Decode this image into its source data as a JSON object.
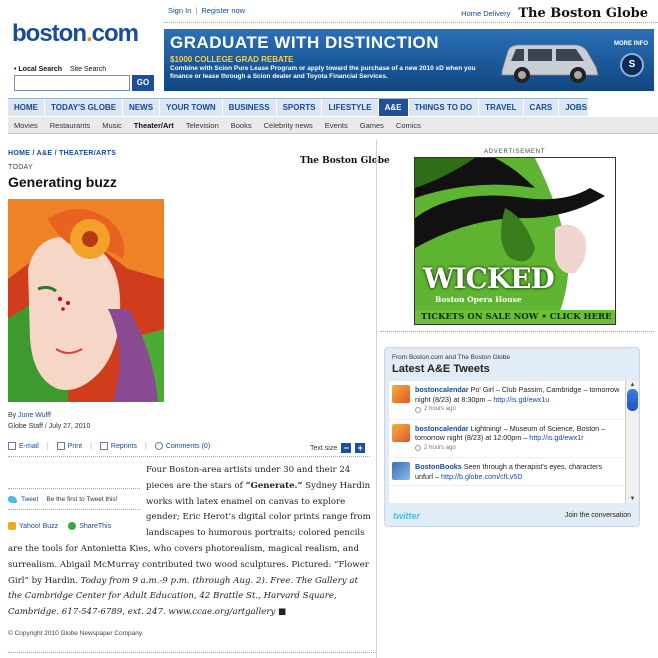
{
  "header": {
    "logo_main": "boston",
    "logo_dot": ".",
    "logo_tld": "com",
    "search_local": "Local Search",
    "search_site": "Site Search",
    "go": "GO",
    "sign_in": "Sign In",
    "register": "Register now",
    "home_delivery": "Home Delivery",
    "masthead": "The Boston Globe"
  },
  "banner": {
    "headline": "GRADUATE WITH DISTINCTION",
    "sub": "$1000 COLLEGE GRAD REBATE",
    "sub2": "Combine with Scion Pure Lease Program or apply toward the purchase of a new 2010 xD when you finance or lease through a Scion dealer and Toyota Financial Services.",
    "more_info": "MORE INFO"
  },
  "nav": {
    "tabs": [
      "HOME",
      "TODAY'S GLOBE",
      "NEWS",
      "YOUR TOWN",
      "BUSINESS",
      "SPORTS",
      "LIFESTYLE",
      "A&E",
      "THINGS TO DO",
      "TRAVEL",
      "CARS",
      "JOBS"
    ],
    "active": "A&E",
    "sub": [
      "Movies",
      "Restaurants",
      "Music",
      "Theater/Art",
      "Television",
      "Books",
      "Celebrity news",
      "Events",
      "Games",
      "Comics"
    ],
    "sub_active": "Theater/Art"
  },
  "article": {
    "breadcrumb": "HOME / A&E / THEATER/ARTS",
    "kicker": "TODAY",
    "source": "The Boston Globe",
    "title": "Generating buzz",
    "by": "By",
    "author": "June Wulff",
    "staff": "Globe Staff",
    "date": "July 27, 2010",
    "tools": [
      "E-mail",
      "Print",
      "Reprints",
      "Comments (0)"
    ],
    "text_size": "Text size",
    "tweet": "Tweet",
    "tweet_first": "Be the first to Tweet this!",
    "yahoo": "Yahoo! Buzz",
    "sharethis": "ShareThis",
    "p1": "Four Boston-area artists under 30 and their 24 pieces are the stars of ",
    "p1_bold": "“Generate.”",
    "p2": " Sydney Hardin works with latex enamel on canvas to explore gender; Eric Herot’s digital color prints range from landscapes to humorous portraits; colored pencils are the tools for Antonietta Kies, who covers photorealism, magical realism, and surrealism. Abigail McMurray contributed two wood sculptures. Pictured: “Flower Girl” by Hardin. ",
    "p3_italic": "Today from 9 a.m.-9 p.m. (through Aug. 2). Free. The Gallery at the Cambridge Center for Adult Education, 42 Brattle St., Harvard Square, Cambridge. 617-547-6789, ext. 247. www.ccae.org/artgallery",
    "end_mark": " ■",
    "copyright": "© Copyright 2010 Globe Newspaper Company."
  },
  "ad": {
    "label": "ADVERTISEMENT",
    "name": "WICKED",
    "venue": "Boston Opera House",
    "cta": "TICKETS ON SALE NOW • CLICK HERE"
  },
  "tweets": {
    "from": "From Boston.com and The Boston Globe",
    "heading": "Latest A&E Tweets",
    "items": [
      {
        "user": "bostoncalendar",
        "text": " Po' Girl – Club Passim, Cambridge – tomorrow night (8/23) at 8:30pm – ",
        "link": "http://is.gd/ewx1u",
        "ago": "2 hours ago"
      },
      {
        "user": "bostoncalendar",
        "text": " Lightning! – Museum of Science, Boston – tomorrow night (8/23) at 12:00pm – ",
        "link": "http://is.gd/ewx1r",
        "ago": "2 hours ago"
      },
      {
        "user": "BostonBooks",
        "text": " Seen through a therapist's eyes, characters unfurl – ",
        "link": "http://b.globe.com/cfLv5D",
        "ago": ""
      }
    ],
    "brand": "twitter",
    "join": "Join the conversation"
  }
}
